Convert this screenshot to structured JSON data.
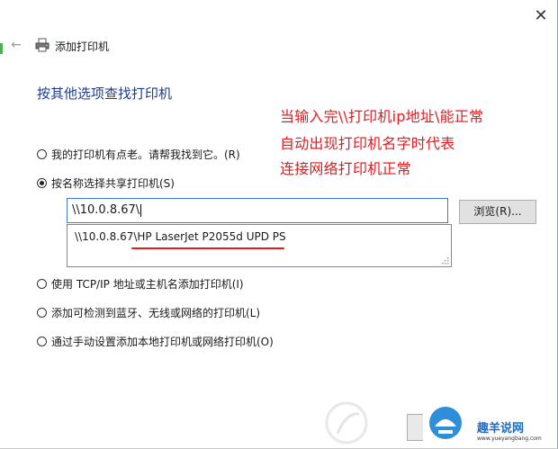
{
  "window": {
    "title": "添加打印机",
    "close_glyph": "✕",
    "back_glyph": "←"
  },
  "heading": "按其他选项查找打印机",
  "annotation": {
    "color": "#e8191e",
    "lines": [
      "当输入完\\\\打印机ip地址\\能正常",
      "自动出现打印机名字时代表",
      "连接网络打印机正常"
    ]
  },
  "options": [
    {
      "label": "我的打印机有点老。请帮我找到它。(R)",
      "checked": false
    },
    {
      "label": "按名称选择共享打印机(S)",
      "checked": true
    },
    {
      "label": "使用 TCP/IP 地址或主机名添加打印机(I)",
      "checked": false
    },
    {
      "label": "添加可检测到蓝牙、无线或网络的打印机(L)",
      "checked": false
    },
    {
      "label": "通过手动设置添加本地打印机或网络打印机(O)",
      "checked": false
    }
  ],
  "share_input": {
    "value": "\\\\10.0.8.67\\"
  },
  "browse_button": "浏览(R)...",
  "suggestion": {
    "prefix": "\\\\10.0.8.67\\",
    "printer": "HP LaserJet P2055d UPD PS"
  },
  "watermark": {
    "brand": "趣羊说网",
    "url": "www.yueyangbang.com"
  },
  "accent_color": "#3c78d8",
  "heading_color": "#1e3d8f"
}
